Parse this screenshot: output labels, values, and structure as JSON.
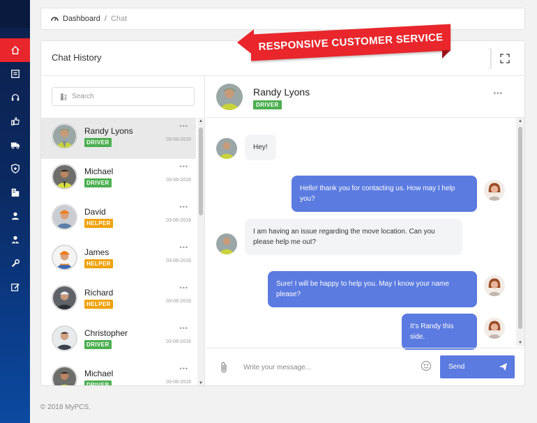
{
  "breadcrumb": {
    "home": "Dashboard",
    "separator": "/",
    "current": "Chat"
  },
  "panel": {
    "title": "Chat History"
  },
  "promo": {
    "ribbon_text": "RESPONSIVE CUSTOMER SERVICE"
  },
  "search": {
    "placeholder": "Search"
  },
  "contacts": [
    {
      "name": "Randy Lyons",
      "role": "DRIVER",
      "date": "03-06-2016"
    },
    {
      "name": "Michael",
      "role": "DRIVER",
      "date": "03-06-2016"
    },
    {
      "name": "David",
      "role": "HELPER",
      "date": "03-06-2016"
    },
    {
      "name": "James",
      "role": "HELPER",
      "date": "03-06-2016"
    },
    {
      "name": "Richard",
      "role": "HELPER",
      "date": "03-06-2016"
    },
    {
      "name": "Christopher",
      "role": "DRIVER",
      "date": "03-06-2016"
    },
    {
      "name": "Michael",
      "role": "DRIVER",
      "date": "03-06-2016"
    }
  ],
  "conversation": {
    "name": "Randy Lyons",
    "role": "DRIVER",
    "messages": [
      {
        "from": "in",
        "text": "Hey!"
      },
      {
        "from": "out",
        "text": "Hello! thank you for contacting us. How may I help you?"
      },
      {
        "from": "in",
        "text": "I am having an issue regarding the move location. Can you please help me out?"
      },
      {
        "from": "out",
        "text": "Sure! I will be happy to help you. May I know your name please?"
      },
      {
        "from": "out",
        "text": "It's Randy this side."
      }
    ]
  },
  "composer": {
    "placeholder": "Write your message...",
    "send_label": "Send"
  },
  "footer": {
    "text": "© 2018 MyPCS."
  },
  "sidebar": {
    "icons": [
      "home-icon",
      "document-icon",
      "headset-icon",
      "thumbs-up-icon",
      "truck-icon",
      "shield-icon",
      "building-icon",
      "user-icon",
      "user-tie-icon",
      "wrench-icon",
      "edit-icon"
    ]
  },
  "colors": {
    "accent_red": "#e8262b",
    "bubble_blue": "#5b7be0",
    "driver_green": "#4caf50",
    "helper_orange": "#f0a20b",
    "sidebar_navy": "#0b2a62"
  }
}
